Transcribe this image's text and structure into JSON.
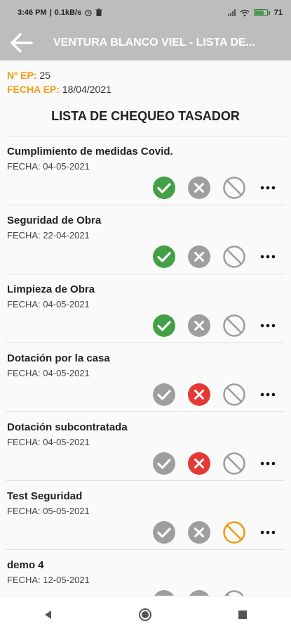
{
  "status_bar": {
    "time": "3:46 PM",
    "speed": "0.1kB/s",
    "battery": "71"
  },
  "app_bar": {
    "title": "VENTURA BLANCO VIEL - LISTA DE..."
  },
  "ep": {
    "number_label": "Nº EP:",
    "number_value": "25",
    "date_label": "FECHA EP:",
    "date_value": "18/04/2021"
  },
  "list_title": "LISTA DE CHEQUEO TASADOR",
  "colors": {
    "approved": "#43a047",
    "rejected": "#e53935",
    "na_active": "#f39c12",
    "inactive": "#9e9e9e",
    "label_orange": "#f39c12"
  },
  "items": [
    {
      "title": "Cumplimiento de medidas Covid.",
      "date": "FECHA: 04-05-2021",
      "state": "approved"
    },
    {
      "title": "Seguridad de Obra",
      "date": "FECHA: 22-04-2021",
      "state": "approved"
    },
    {
      "title": "Limpieza de Obra",
      "date": "FECHA: 04-05-2021",
      "state": "approved"
    },
    {
      "title": "Dotación por la casa",
      "date": "FECHA: 04-05-2021",
      "state": "rejected"
    },
    {
      "title": "Dotación subcontratada",
      "date": "FECHA: 04-05-2021",
      "state": "rejected"
    },
    {
      "title": "Test Seguridad",
      "date": "FECHA: 05-05-2021",
      "state": "na"
    },
    {
      "title": "demo 4",
      "date": "FECHA: 12-05-2021",
      "state": "none"
    }
  ],
  "icons": {
    "approve": "check-circle-icon",
    "reject": "x-circle-icon",
    "not_applicable": "no-entry-icon",
    "more": "more-horizontal-icon"
  }
}
